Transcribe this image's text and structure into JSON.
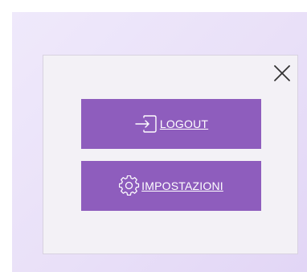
{
  "dialog": {
    "close_icon": "close-icon",
    "buttons": [
      {
        "label": "LOGOUT",
        "icon": "logout-icon"
      },
      {
        "label": "IMPOSTAZIONI",
        "icon": "gear-icon"
      }
    ]
  },
  "colors": {
    "button_background": "#8e5dbd",
    "button_text": "#ffffff",
    "panel_background": "#f3f1f6",
    "frame_background": "#e9e0f8",
    "close_icon": "#333333"
  }
}
